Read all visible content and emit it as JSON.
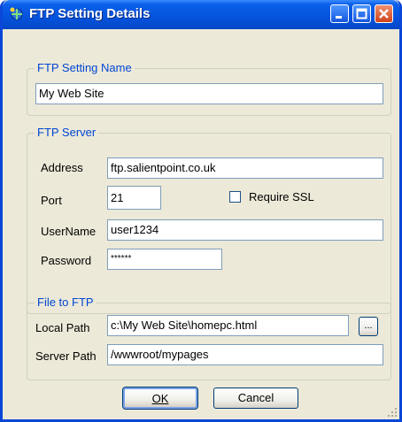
{
  "window": {
    "title": "FTP Setting Details"
  },
  "setting_group": {
    "legend": "FTP Setting Name",
    "name_value": "My Web Site"
  },
  "server_group": {
    "legend": "FTP Server",
    "address_label": "Address",
    "address_value": "ftp.salientpoint.co.uk",
    "port_label": "Port",
    "port_value": "21",
    "ssl_label": "Require SSL",
    "ssl_checked": false,
    "username_label": "UserName",
    "username_value": "user1234",
    "password_label": "Password",
    "password_value": "******"
  },
  "file_group": {
    "legend": "File to FTP",
    "local_label": "Local Path",
    "local_value": "c:\\My Web Site\\homepc.html",
    "browse_label": "...",
    "server_label": "Server Path",
    "server_value": "/wwwroot/mypages"
  },
  "buttons": {
    "ok_label": "OK",
    "cancel_label": "Cancel"
  }
}
